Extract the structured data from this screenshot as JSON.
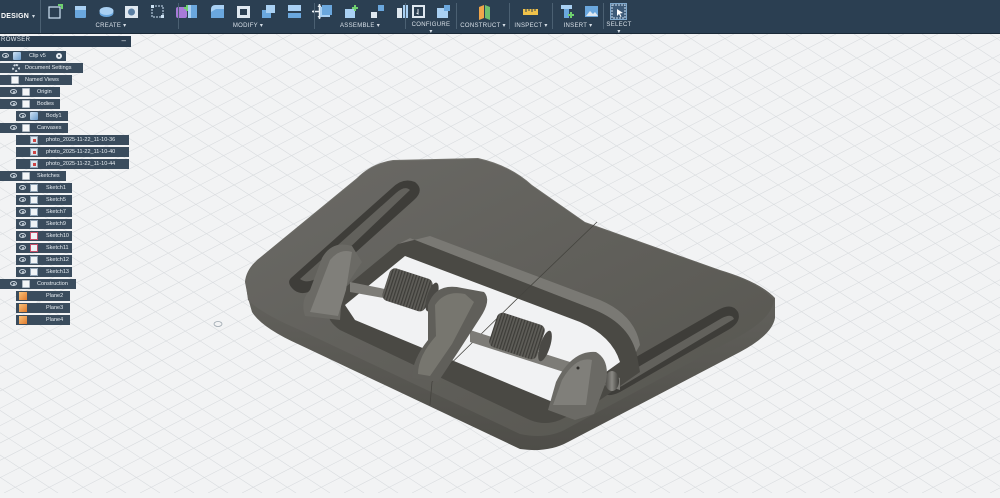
{
  "toolbar": {
    "workspace": "DESIGN",
    "groups": [
      {
        "label": "CREATE ▾"
      },
      {
        "label": "MODIFY ▾"
      },
      {
        "label": "ASSEMBLE ▾"
      },
      {
        "label": "CONFIGURE ▾"
      },
      {
        "label": "CONSTRUCT ▾"
      },
      {
        "label": "INSPECT ▾"
      },
      {
        "label": "INSERT ▾"
      },
      {
        "label": "SELECT ▾"
      }
    ]
  },
  "browser": {
    "title": "ROWSER",
    "root": "Clip v5",
    "items": [
      {
        "label": "Document Settings"
      },
      {
        "label": "Named Views"
      },
      {
        "label": "Origin"
      },
      {
        "label": "Bodies"
      },
      {
        "label": "Body1"
      },
      {
        "label": "Canvases"
      },
      {
        "label": "photo_2025-11-22_11-10-36"
      },
      {
        "label": "photo_2025-11-22_11-10-40"
      },
      {
        "label": "photo_2025-11-22_11-10-44"
      },
      {
        "label": "Sketches"
      },
      {
        "label": "Sketch1"
      },
      {
        "label": "Sketch5"
      },
      {
        "label": "Sketch7"
      },
      {
        "label": "Sketch9"
      },
      {
        "label": "Sketch10"
      },
      {
        "label": "Sketch11"
      },
      {
        "label": "Sketch12"
      },
      {
        "label": "Sketch13"
      },
      {
        "label": "Construction"
      },
      {
        "label": "Plane2"
      },
      {
        "label": "Plane3"
      },
      {
        "label": "Plane4"
      }
    ]
  },
  "colors": {
    "toolbar": "#2b3f52",
    "panel": "#3a4c5d",
    "model": "#5b5a56",
    "accent": "#4ea3e0"
  }
}
